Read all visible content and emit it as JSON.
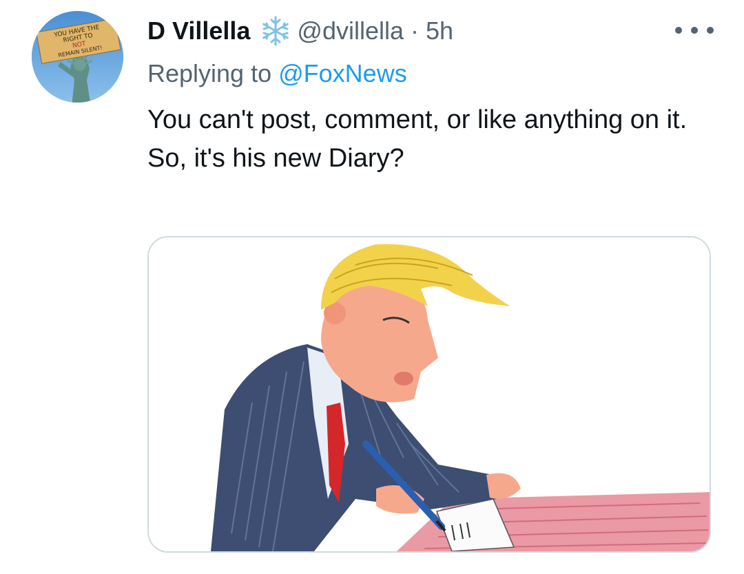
{
  "tweet": {
    "display_name": "D Villella",
    "name_icon": "snowflake-icon",
    "handle": "@dvillella",
    "separator": "·",
    "time": "5h",
    "more_icon": "more-horizontal-icon",
    "replying_prefix": "Replying to",
    "replying_to": "@FoxNews",
    "body_lines": [
      "You can't post, comment, or like anything on it.",
      "So, it's his new Diary?"
    ],
    "media_icon": "political-cartoon-image"
  },
  "avatar": {
    "icon": "statue-of-liberty-avatar",
    "sign_lines": [
      "YOU HAVE THE",
      "RIGHT TO",
      "NOT",
      "REMAIN SILENT!"
    ]
  },
  "colors": {
    "text_primary": "#0f1419",
    "text_secondary": "#536471",
    "link": "#1d9bf0",
    "border": "#cfd9de"
  }
}
